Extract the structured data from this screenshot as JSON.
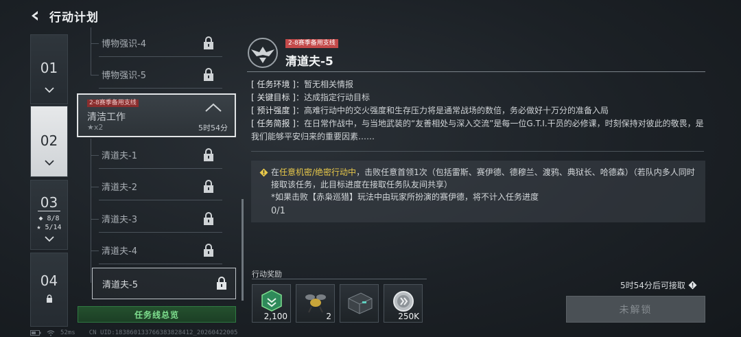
{
  "header": {
    "title": "行动计划"
  },
  "chapters": [
    {
      "num": "01"
    },
    {
      "num": "02"
    },
    {
      "num": "03",
      "stat1": "◆ 8/8",
      "stat2": "★ 5/14"
    },
    {
      "num": "04"
    }
  ],
  "mission_list": {
    "upper_items": [
      "博物强识-4",
      "博物强识-5"
    ],
    "group": {
      "tag": "2-8赛季备用支线",
      "title": "清洁工作",
      "stars": "★x2",
      "time": "5时54分"
    },
    "lower_items": [
      "清道夫-1",
      "清道夫-2",
      "清道夫-3",
      "清道夫-4",
      "清道夫-5"
    ],
    "summary_label": "任务线总览"
  },
  "detail": {
    "tag": "2-8赛季备用支线",
    "title": "清道夫-5",
    "info": [
      {
        "key": "[ 任务环境 ]",
        "value": "：暂无相关情报"
      },
      {
        "key": "[ 关键目标 ]",
        "value": "：达成指定行动目标"
      },
      {
        "key": "[ 预计强度 ]",
        "value": "：高难行动中的交火强度和生存压力将是通常战场的数倍，务必做好十万分的准备入局"
      },
      {
        "key": "[ 任务简报 ]",
        "value": "：在日常作战中，与当地武装的“友善相处与深入交流”是每一位G.T.I.干员的必修课，时刻保持对彼此的敬畏，是我们能够平安归来的重要因素……"
      }
    ],
    "objective": {
      "prefix": "在",
      "highlight": "任意机密/绝密行动中",
      "body": "，击败任意首领1次（包括雷斯、赛伊德、德穆兰、渡鸦、典狱长、哈德森）（若队内多人同时接取该任务，此目标进度在接取任务队友间共享）",
      "note": "*如果击败【赤枭巡猎】玩法中由玩家所扮演的赛伊德，将不计入任务进度",
      "progress": "0/1"
    }
  },
  "rewards": {
    "label": "行动奖励",
    "items": [
      {
        "icon": "green-badge-icon",
        "amount": "2,100"
      },
      {
        "icon": "bee-drone-icon",
        "amount": "2"
      },
      {
        "icon": "crate-icon",
        "amount": ""
      },
      {
        "icon": "coin-icon",
        "amount": "250K"
      }
    ]
  },
  "unlock": {
    "hint": "5时54分后可接取",
    "button_label": "未解锁"
  },
  "status_bar": {
    "ping": "52ms",
    "uid": "CN UID:183860133766383828412_20260422005"
  },
  "colors": {
    "accent_green": "#7fe08f",
    "tag_red": "#c44a4a",
    "highlight_yellow": "#e8c84a"
  }
}
